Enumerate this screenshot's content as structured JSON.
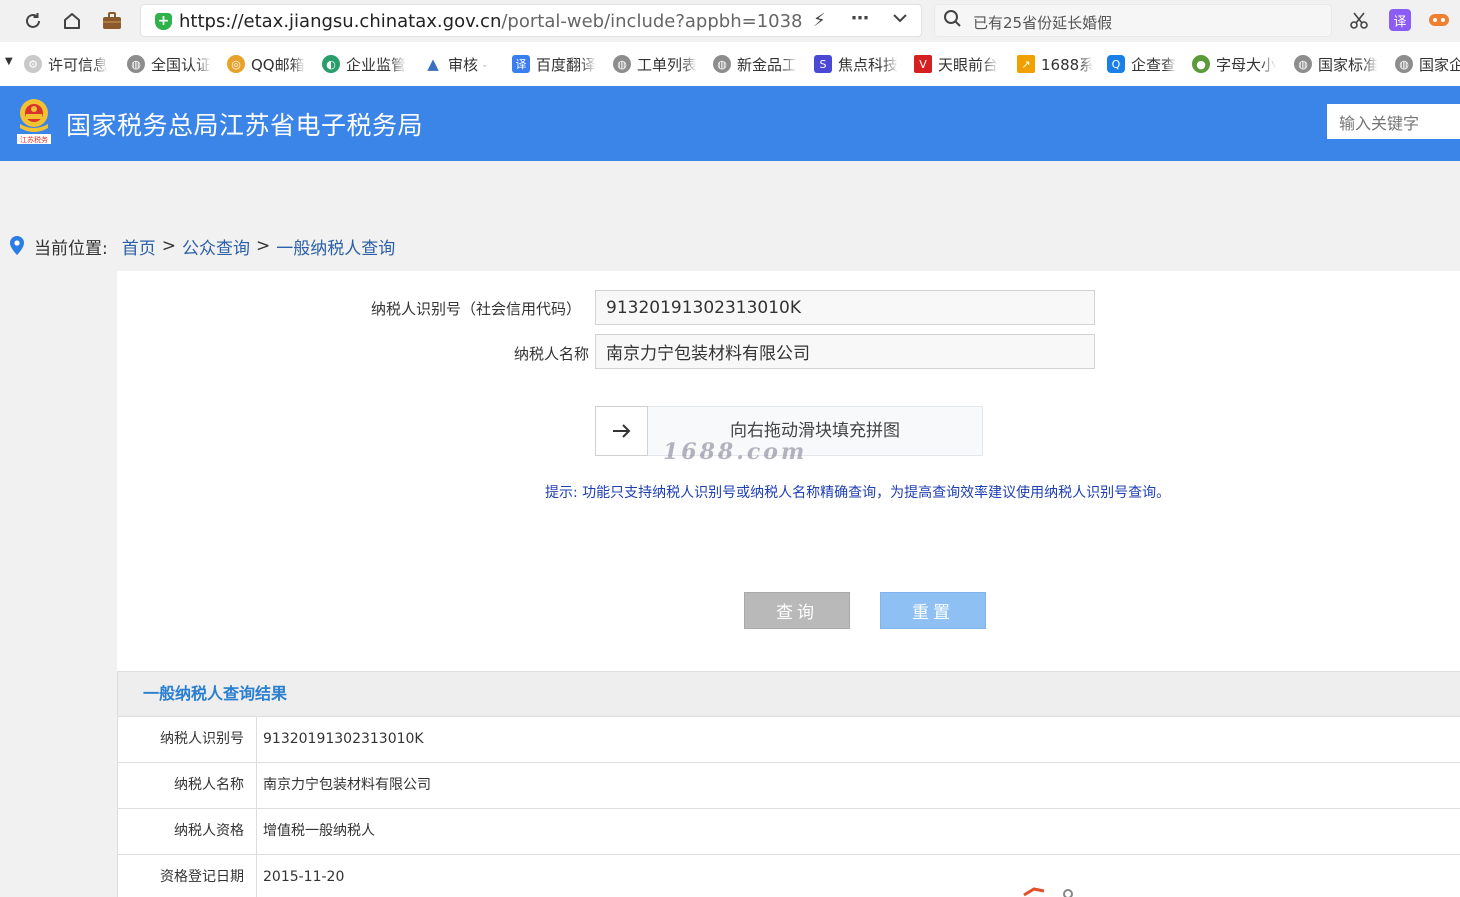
{
  "browser": {
    "url_host": "https://etax.jiangsu.chinatax.gov.cn",
    "url_path": "/portal-web/include?appbh=1038",
    "search_text": "已有25省份延长婚假",
    "translate_label": "译"
  },
  "bookmarks": [
    {
      "label": "许可信息",
      "icon": "gear-icon",
      "color": "#c9c9c9"
    },
    {
      "label": "全国认证",
      "icon": "globe-icon",
      "color": "#8d8d8d"
    },
    {
      "label": "QQ邮箱",
      "icon": "qq-mail-icon",
      "color": "#e8a22a"
    },
    {
      "label": "企业监管",
      "icon": "swirl-icon",
      "color": "#2a9e6a"
    },
    {
      "label": "审核 -",
      "icon": "triangle-icon",
      "color": "#3a6fc4"
    },
    {
      "label": "百度翻译",
      "icon": "translate-icon",
      "color": "#3a7ef0"
    },
    {
      "label": "工单列表",
      "icon": "globe-icon",
      "color": "#8d8d8d"
    },
    {
      "label": "新金品工",
      "icon": "globe-icon",
      "color": "#8d8d8d"
    },
    {
      "label": "焦点科技",
      "icon": "focus-icon",
      "color": "#4b48d6"
    },
    {
      "label": "天眼前台",
      "icon": "v-icon",
      "color": "#d42020"
    },
    {
      "label": "1688系",
      "icon": "chart-icon",
      "color": "#f0a000"
    },
    {
      "label": "企查查",
      "icon": "qcc-icon",
      "color": "#1a7fe6"
    },
    {
      "label": "字母大小",
      "icon": "frog-icon",
      "color": "#5a9a3a"
    },
    {
      "label": "国家标准",
      "icon": "globe-icon",
      "color": "#8d8d8d"
    },
    {
      "label": "国家企",
      "icon": "globe-icon",
      "color": "#8d8d8d"
    }
  ],
  "site": {
    "title": "国家税务总局江苏省电子税务局",
    "emblem_caption": "江苏税务",
    "search_placeholder": "输入关键字"
  },
  "breadcrumb": {
    "prefix": "当前位置:",
    "items": [
      "首页",
      "公众查询",
      "一般纳税人查询"
    ],
    "separator": ">"
  },
  "form": {
    "tax_id_label": "纳税人识别号（社会信用代码）",
    "tax_id_value": "91320191302313010K",
    "name_label": "纳税人名称",
    "name_value": "南京力宁包装材料有限公司",
    "slider_text": "向右拖动滑块填充拼图",
    "hint": "提示:   功能只支持纳税人识别号或纳税人名称精确查询，为提高查询效率建议使用纳税人识别号查询。",
    "query_button": "查询",
    "reset_button": "重置"
  },
  "watermark": "1688.com",
  "results": {
    "title": "一般纳税人查询结果",
    "rows": [
      {
        "label": "纳税人识别号",
        "value": "91320191302313010K"
      },
      {
        "label": "纳税人名称",
        "value": "南京力宁包装材料有限公司"
      },
      {
        "label": "纳税人资格",
        "value": "增值税一般纳税人"
      },
      {
        "label": "资格登记日期",
        "value": "2015-11-20"
      }
    ]
  },
  "colors": {
    "header_blue": "#3b84e8",
    "link_blue": "#2b5fa8",
    "hint_blue": "#1e3fb5",
    "result_title_blue": "#2a7fd0",
    "reset_button": "#8ec0f3",
    "query_button": "#b9b9b9"
  }
}
